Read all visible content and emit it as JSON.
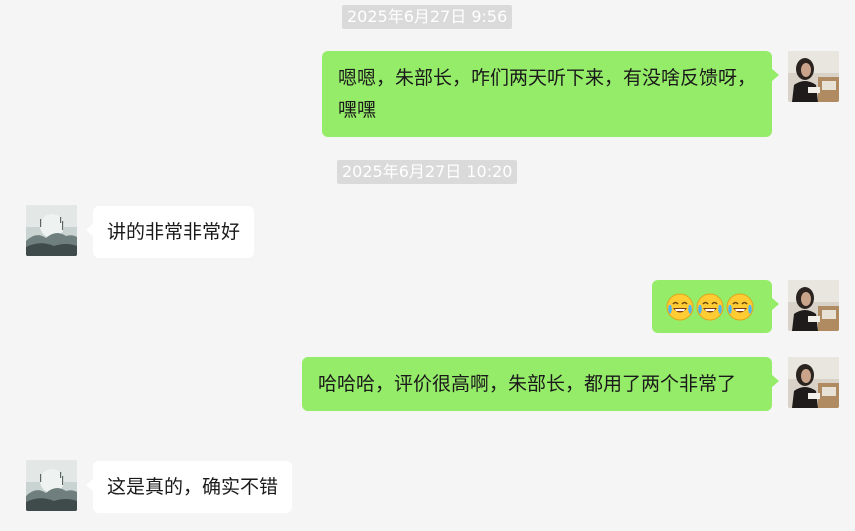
{
  "messages": [
    {
      "type": "timestamp",
      "text": "2025年6月27日 9:56"
    },
    {
      "type": "outgoing",
      "text": "嗯嗯，朱部长，咋们两天听下来，有没啥反馈呀，嘿嘿",
      "avatar": "woman-reading-avatar"
    },
    {
      "type": "timestamp",
      "text": "2025年6月27日 10:20"
    },
    {
      "type": "incoming",
      "text": "讲的非常非常好",
      "avatar": "ink-landscape-avatar"
    },
    {
      "type": "outgoing",
      "emojis": [
        "tears-of-joy-emoji",
        "tears-of-joy-emoji",
        "tears-of-joy-emoji"
      ],
      "avatar": "woman-reading-avatar"
    },
    {
      "type": "outgoing",
      "text": "哈哈哈，评价很高啊，朱部长，都用了两个非常了",
      "avatar": "woman-reading-avatar"
    },
    {
      "type": "incoming",
      "text": "这是真的，确实不错",
      "avatar": "ink-landscape-avatar"
    }
  ],
  "colors": {
    "background": "#f5f5f5",
    "outgoing_bubble": "#95ec69",
    "incoming_bubble": "#ffffff",
    "timestamp_bg": "#dadada"
  }
}
